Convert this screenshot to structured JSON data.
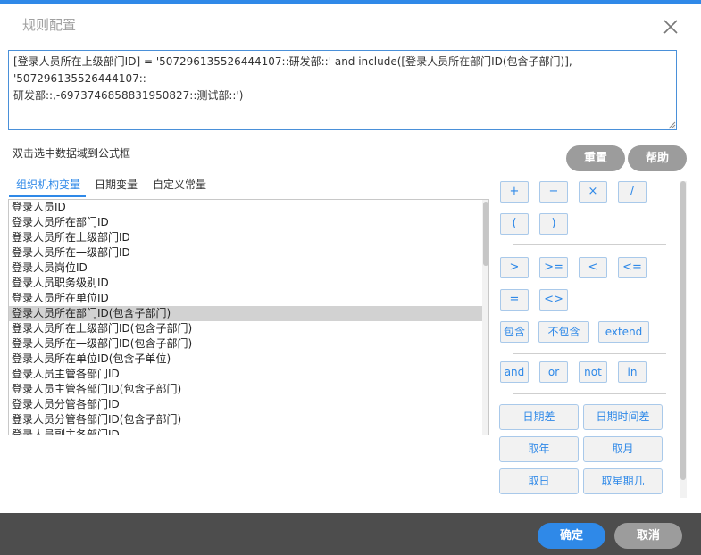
{
  "dialog": {
    "title": "规则配置"
  },
  "formula": {
    "line1": "[登录人员所在上级部门ID] =  '507296135526444107::研发部::'  and include([登录人员所在部门ID(包含子部门)], '507296135526444107::",
    "line2": "研发部::,-697374685883195082​7::测试部::')"
  },
  "hint": "双击选中数据域到公式框",
  "buttons": {
    "reset": "重置",
    "help": "帮助",
    "ok": "确定",
    "cancel": "取消"
  },
  "tabs": [
    "组织机构变量",
    "日期变量",
    "自定义常量"
  ],
  "variables": [
    "登录人员ID",
    "登录人员所在部门ID",
    "登录人员所在上级部门ID",
    "登录人员所在一级部门ID",
    "登录人员岗位ID",
    "登录人员职务级别ID",
    "登录人员所在单位ID",
    "登录人员所在部门ID(包含子部门)",
    "登录人员所在上级部门ID(包含子部门)",
    "登录人员所在一级部门ID(包含子部门)",
    "登录人员所在单位ID(包含子单位)",
    "登录人员主管各部门ID",
    "登录人员主管各部门ID(包含子部门)",
    "登录人员分管各部门ID",
    "登录人员分管各部门ID(包含子部门)",
    "登录人员副主各部门ID"
  ],
  "selected_index": 7,
  "operators": {
    "arith": [
      "+",
      "−",
      "×",
      "/"
    ],
    "parens": [
      "(",
      ")"
    ],
    "compare": [
      ">",
      ">=",
      "<",
      "<="
    ],
    "equals": [
      "=",
      "<>"
    ],
    "contain": [
      "包含",
      "不包含",
      "extend"
    ],
    "logic": [
      "and",
      "or",
      "not",
      "in"
    ],
    "functions": [
      "日期差",
      "日期时间差",
      "取年",
      "取月",
      "取日",
      "取星期几"
    ]
  },
  "colors": {
    "accent": "#2f89e8",
    "gray_button": "#9c9c9c",
    "footer": "#4d4d4d"
  }
}
